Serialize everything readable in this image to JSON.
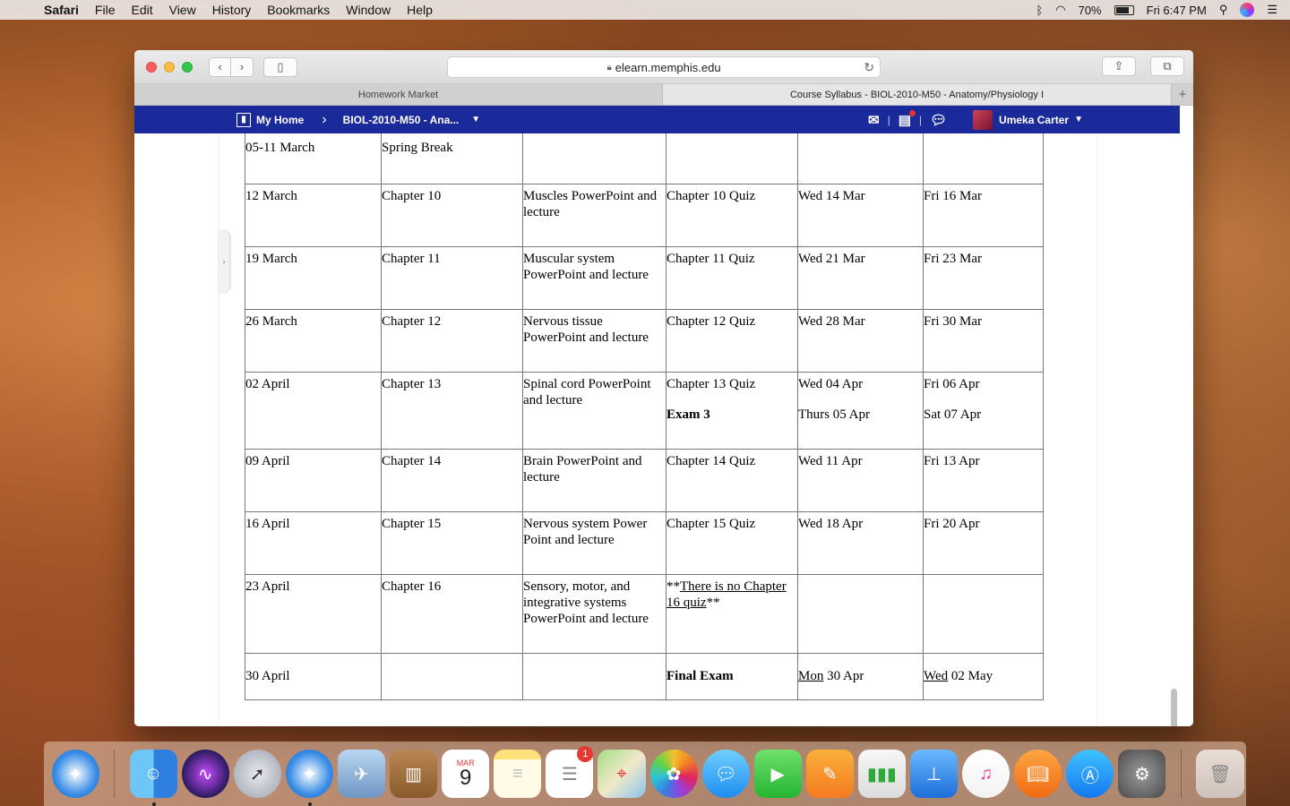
{
  "menubar": {
    "app": "Safari",
    "items": [
      "File",
      "Edit",
      "View",
      "History",
      "Bookmarks",
      "Window",
      "Help"
    ],
    "battery": "70%",
    "clock": "Fri 6:47 PM"
  },
  "browser": {
    "url": "elearn.memphis.edu",
    "tabs": [
      "Homework Market",
      "Course Syllabus - BIOL-2010-M50 - Anatomy/Physiology I"
    ],
    "active_tab": 1
  },
  "lms": {
    "my_home": "My Home",
    "course": "BIOL-2010-M50 - Ana...",
    "user": "Umeka Carter"
  },
  "schedule": {
    "rows": [
      {
        "week": "05-11 March",
        "chapter": "Spring Break",
        "activity": "",
        "assessment": "",
        "open": "",
        "due": ""
      },
      {
        "week": "12 March",
        "chapter": "Chapter 10",
        "activity": "Muscles PowerPoint and lecture",
        "assessment": "Chapter 10 Quiz",
        "open": "Wed 14 Mar",
        "due": "Fri 16 Mar"
      },
      {
        "week": "19 March",
        "chapter": "Chapter 11",
        "activity": "Muscular system PowerPoint and lecture",
        "assessment": "Chapter 11 Quiz",
        "open": "Wed 21 Mar",
        "due": "Fri 23 Mar"
      },
      {
        "week": "26 March",
        "chapter": "Chapter 12",
        "activity": "Nervous tissue PowerPoint and lecture",
        "assessment": "Chapter 12 Quiz",
        "open": "Wed 28 Mar",
        "due": "Fri 30 Mar"
      },
      {
        "week": "02 April",
        "chapter": "Chapter 13",
        "activity": "Spinal cord PowerPoint and lecture",
        "assessment": "Chapter 13 Quiz",
        "assessment2": "Exam 3",
        "open": "Wed 04 Apr",
        "open2": "Thurs 05 Apr",
        "due": "Fri 06 Apr",
        "due2": "Sat 07 Apr"
      },
      {
        "week": "09 April",
        "chapter": "Chapter 14",
        "activity": "Brain PowerPoint and lecture",
        "assessment": "Chapter 14 Quiz",
        "open": "Wed 11 Apr",
        "due": "Fri 13 Apr"
      },
      {
        "week": "16 April",
        "chapter": "Chapter 15",
        "activity": "Nervous system Power Point and lecture",
        "assessment": "Chapter 15 Quiz",
        "open": "Wed 18 Apr",
        "due": "Fri 20 Apr"
      },
      {
        "week": "23 April",
        "chapter": "Chapter 16",
        "activity": "Sensory, motor, and integrative systems PowerPoint and lecture",
        "assessment_pre": "**",
        "assessment_link": "There is no Chapter 16 quiz",
        "assessment_post": "**",
        "open": "",
        "due": ""
      },
      {
        "week": "30 April",
        "chapter": "",
        "activity": "",
        "assessment": "Final Exam",
        "open_day": "Mon",
        "open_rest": " 30 Apr",
        "due_day": "Wed",
        "due_rest": " 02 May"
      }
    ]
  },
  "dock": {
    "apps": [
      "Safari",
      "Finder",
      "Siri",
      "Launchpad",
      "Safari",
      "Preview",
      "Notebooks",
      "Calendar",
      "Notes",
      "Reminders",
      "Maps",
      "Photos",
      "Messages",
      "FaceTime",
      "Pages",
      "Numbers",
      "Keynote",
      "iTunes",
      "iBooks",
      "App Store",
      "System Preferences",
      "Trash"
    ],
    "calendar_month": "MAR",
    "calendar_day": "9",
    "reminders_badge": "1"
  },
  "colors": {
    "lms_bar": "#1b2a9a",
    "table_border": "#777777"
  }
}
